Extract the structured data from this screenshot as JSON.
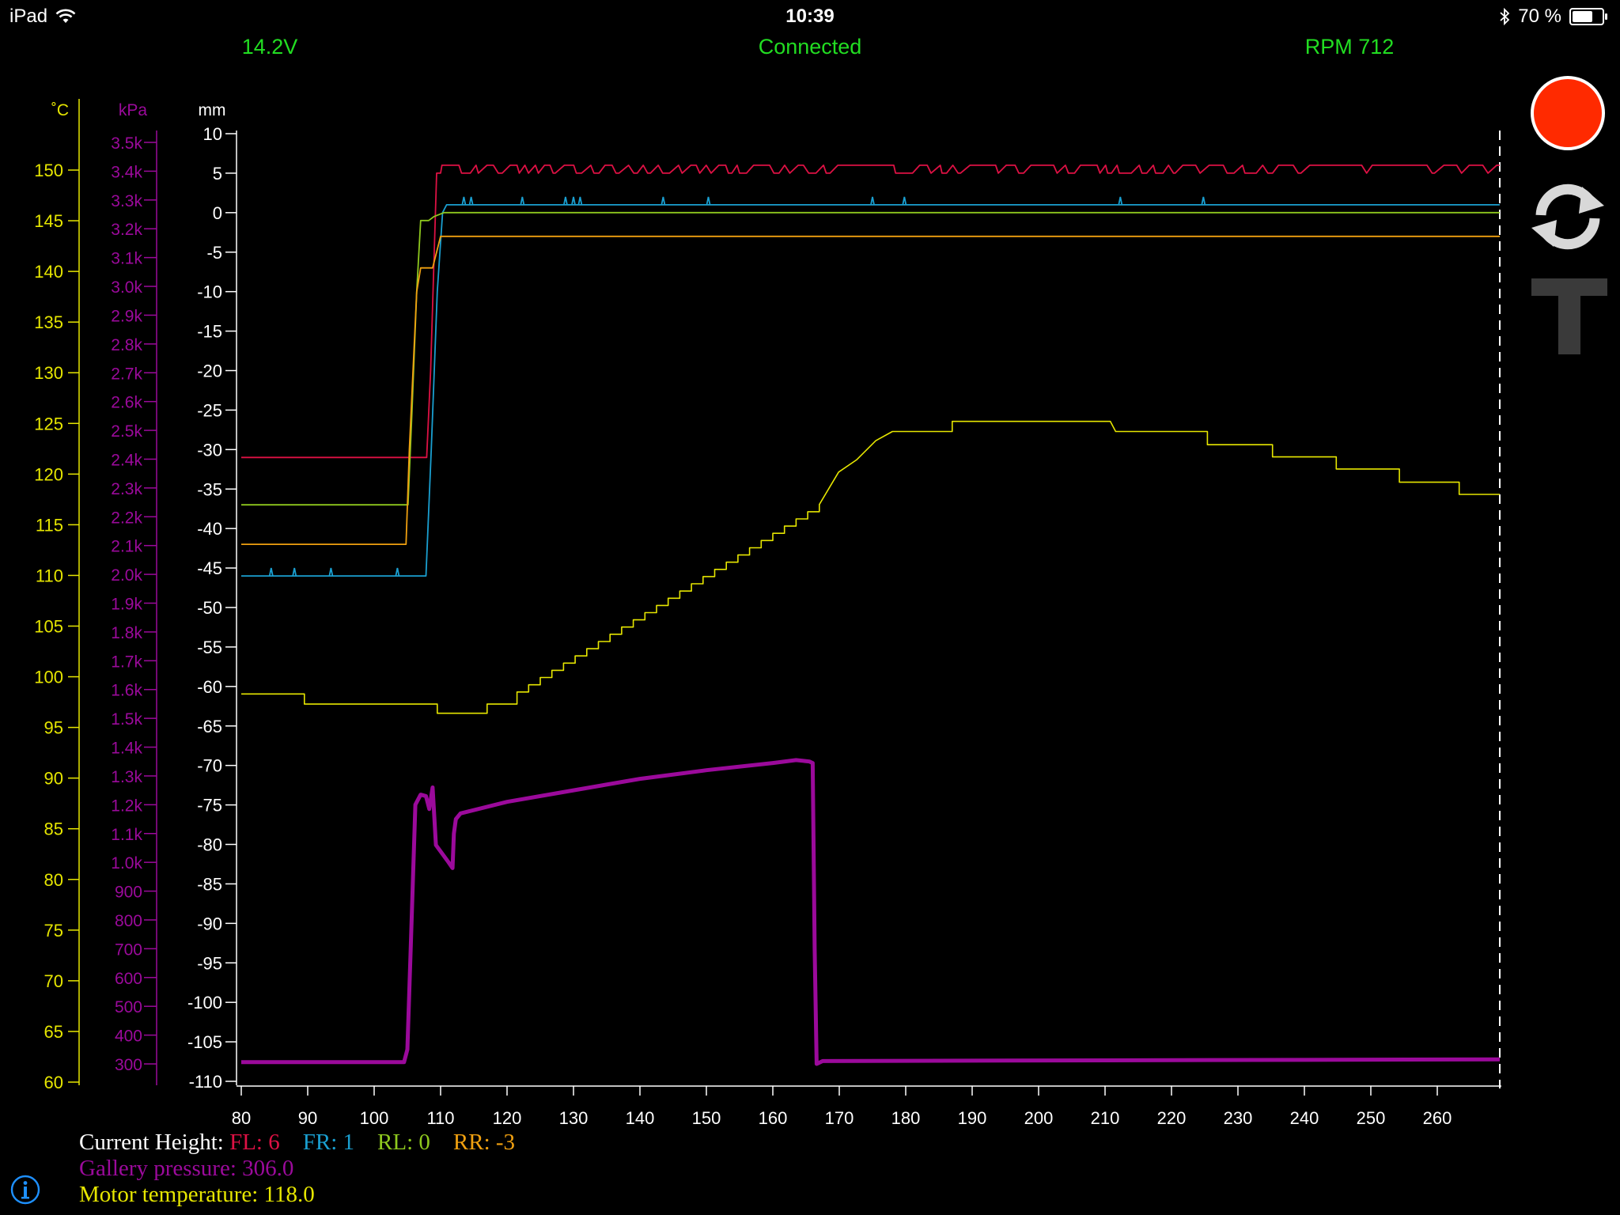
{
  "status_bar": {
    "device": "iPad",
    "time": "10:39",
    "battery": "70 %",
    "battery_level": 0.7
  },
  "top_bar": {
    "voltage": "14.2V",
    "connection": "Connected",
    "rpm": "RPM 712"
  },
  "colors": {
    "FL": "#dd1144",
    "FR": "#1a9fd0",
    "RL": "#8ec81e",
    "RR": "#f0a010",
    "temperature": "#e6e600",
    "pressure": "#9b0a9b",
    "status_green": "#22dd22",
    "record": "#ff2a00"
  },
  "icons": {
    "wifi": "wifi-icon",
    "bluetooth": "bluetooth-icon",
    "battery": "battery-icon",
    "record": "record-button",
    "refresh": "refresh-icon",
    "tool": "text-tool-icon",
    "info": "info-icon"
  },
  "legend": {
    "height_label": "Current Height:",
    "fl": "FL: 6",
    "fr": "FR: 1",
    "rl": "RL: 0",
    "rr": "RR: -3",
    "pressure": "Gallery pressure: 306.0",
    "temperature": "Motor temperature: 118.0"
  },
  "chart_data": {
    "type": "line",
    "x": {
      "range": [
        80,
        270
      ],
      "ticks": [
        80,
        90,
        100,
        110,
        120,
        130,
        140,
        150,
        160,
        170,
        180,
        190,
        200,
        210,
        220,
        230,
        240,
        250,
        260
      ],
      "cursor": 270
    },
    "axes": {
      "temperature": {
        "label": "˚C",
        "range": [
          60,
          150
        ],
        "step": 5
      },
      "pressure": {
        "label": "kPa",
        "range": [
          300,
          3500
        ],
        "step": 100
      },
      "height": {
        "label": "mm",
        "range": [
          -110,
          10
        ],
        "step": 5
      }
    },
    "series": [
      {
        "name": "FL",
        "axis": "height",
        "points": [
          [
            80,
            -31
          ],
          [
            107.9,
            -31
          ],
          [
            108.5,
            -20
          ],
          [
            109.4,
            5
          ],
          [
            110,
            5
          ],
          [
            110.2,
            6
          ],
          [
            111,
            6
          ],
          [
            270,
            6
          ]
        ],
        "noise": {
          "from": 111,
          "to": 270,
          "base": 5,
          "peak": 6,
          "amp": 1
        }
      },
      {
        "name": "FR",
        "axis": "height",
        "points": [
          [
            80,
            -46
          ],
          [
            107.8,
            -46
          ],
          [
            108.6,
            -30
          ],
          [
            109.5,
            -10
          ],
          [
            110.3,
            0
          ],
          [
            110.9,
            1
          ],
          [
            270,
            1
          ]
        ],
        "spikes": [
          [
            84.5,
            -46,
            -45
          ],
          [
            88,
            -46,
            -45
          ],
          [
            93.5,
            -46,
            -45
          ],
          [
            103.5,
            -46,
            -45
          ],
          [
            113.5,
            1,
            2
          ],
          [
            114.6,
            1,
            2
          ],
          [
            122.3,
            1,
            2
          ],
          [
            128.8,
            1,
            2
          ],
          [
            130,
            1,
            2
          ],
          [
            131,
            1,
            2
          ],
          [
            143.5,
            1,
            2
          ],
          [
            150.3,
            1,
            2
          ],
          [
            175,
            1,
            2
          ],
          [
            179.8,
            1,
            2
          ],
          [
            212.3,
            1,
            2
          ],
          [
            224.8,
            1,
            2
          ]
        ]
      },
      {
        "name": "RL",
        "axis": "height",
        "points": [
          [
            80,
            -37
          ],
          [
            105.1,
            -37
          ],
          [
            105.7,
            -25
          ],
          [
            106.4,
            -10
          ],
          [
            107,
            -1
          ],
          [
            108.2,
            -1
          ],
          [
            109,
            -0.5
          ],
          [
            110.5,
            0
          ],
          [
            270,
            0
          ]
        ],
        "noise": {
          "from": 80,
          "to": 105,
          "base": -37,
          "peak": -36,
          "amp": 1
        }
      },
      {
        "name": "RR",
        "axis": "height",
        "points": [
          [
            80,
            -42
          ],
          [
            104.8,
            -42
          ],
          [
            105.3,
            -30
          ],
          [
            106.4,
            -10
          ],
          [
            107,
            -7
          ],
          [
            108.8,
            -7
          ],
          [
            110,
            -3
          ],
          [
            270,
            -3
          ]
        ]
      },
      {
        "name": "Motor temperature",
        "axis": "temperature",
        "points": [
          [
            80,
            98.3
          ],
          [
            89.5,
            98.3
          ],
          [
            89.5,
            97.3
          ],
          [
            109.5,
            97.3
          ],
          [
            109.5,
            96.4
          ],
          [
            117,
            96.4
          ],
          [
            117,
            97.3
          ],
          [
            121.5,
            97.3
          ],
          [
            121.5,
            98.5
          ],
          [
            167,
            117
          ],
          [
            169.9,
            120.2
          ],
          [
            172.6,
            121.4
          ],
          [
            175.5,
            123.3
          ],
          [
            178,
            124.2
          ],
          [
            178,
            124.2
          ],
          [
            187,
            124.2
          ],
          [
            187,
            125.2
          ],
          [
            210.8,
            125.2
          ],
          [
            211.6,
            124.2
          ],
          [
            225.4,
            124.2
          ],
          [
            225.4,
            122.9
          ],
          [
            235.2,
            122.9
          ],
          [
            235.2,
            121.7
          ],
          [
            244.8,
            121.7
          ],
          [
            244.8,
            120.5
          ],
          [
            254.3,
            120.5
          ],
          [
            254.3,
            119.2
          ],
          [
            263.3,
            119.2
          ],
          [
            263.3,
            118
          ],
          [
            270,
            118
          ]
        ],
        "staircase": {
          "from": 121.5,
          "to": 178,
          "steps": 26
        }
      },
      {
        "name": "Gallery pressure",
        "axis": "pressure",
        "points": [
          [
            80,
            306
          ],
          [
            104.5,
            306
          ],
          [
            105,
            350
          ],
          [
            105.5,
            700
          ],
          [
            106.2,
            1200
          ],
          [
            107,
            1235
          ],
          [
            107.8,
            1230
          ],
          [
            108.3,
            1185
          ],
          [
            108.8,
            1260
          ],
          [
            109.3,
            1060
          ],
          [
            111.2,
            1000
          ],
          [
            111.8,
            980
          ],
          [
            112,
            1100
          ],
          [
            112.3,
            1150
          ],
          [
            113,
            1170
          ],
          [
            120,
            1210
          ],
          [
            130,
            1250
          ],
          [
            140,
            1290
          ],
          [
            150,
            1320
          ],
          [
            160,
            1345
          ],
          [
            163.5,
            1355
          ],
          [
            165.5,
            1350
          ],
          [
            166,
            1345
          ],
          [
            166.3,
            700
          ],
          [
            166.6,
            300
          ],
          [
            167.5,
            310
          ],
          [
            270,
            316
          ]
        ]
      }
    ]
  }
}
